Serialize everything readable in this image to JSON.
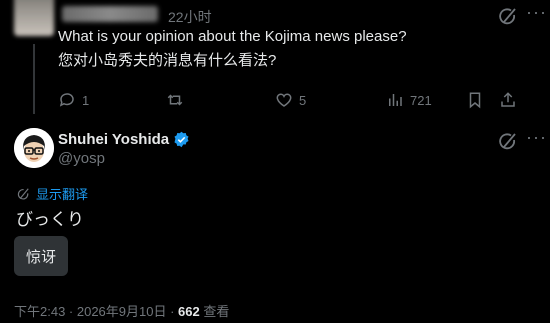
{
  "parent_tweet": {
    "timestamp": "22小时",
    "text_en": "What is your opinion about the Kojima news please?",
    "text_zh": "您对小岛秀夫的消息有什么看法?",
    "reply_count": "1",
    "like_count": "5",
    "view_count": "721"
  },
  "main_tweet": {
    "display_name": "Shuhei Yoshida",
    "handle": "@yosp",
    "show_translation_label": "显示翻译",
    "text": "びっくり",
    "translation_text": "惊讶",
    "time_date": "下午2:43 · 2026年9月10日 · ",
    "view_count": "662",
    "view_label": " 查看"
  },
  "colors": {
    "accent": "#1d9bf0",
    "muted": "#71767b",
    "background": "#000000"
  }
}
